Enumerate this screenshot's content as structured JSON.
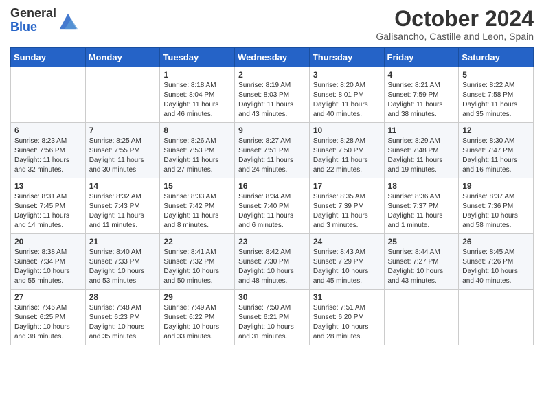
{
  "logo": {
    "general": "General",
    "blue": "Blue"
  },
  "title": "October 2024",
  "location": "Galisancho, Castille and Leon, Spain",
  "days_header": [
    "Sunday",
    "Monday",
    "Tuesday",
    "Wednesday",
    "Thursday",
    "Friday",
    "Saturday"
  ],
  "weeks": [
    [
      {
        "day": "",
        "info": ""
      },
      {
        "day": "",
        "info": ""
      },
      {
        "day": "1",
        "info": "Sunrise: 8:18 AM\nSunset: 8:04 PM\nDaylight: 11 hours and 46 minutes."
      },
      {
        "day": "2",
        "info": "Sunrise: 8:19 AM\nSunset: 8:03 PM\nDaylight: 11 hours and 43 minutes."
      },
      {
        "day": "3",
        "info": "Sunrise: 8:20 AM\nSunset: 8:01 PM\nDaylight: 11 hours and 40 minutes."
      },
      {
        "day": "4",
        "info": "Sunrise: 8:21 AM\nSunset: 7:59 PM\nDaylight: 11 hours and 38 minutes."
      },
      {
        "day": "5",
        "info": "Sunrise: 8:22 AM\nSunset: 7:58 PM\nDaylight: 11 hours and 35 minutes."
      }
    ],
    [
      {
        "day": "6",
        "info": "Sunrise: 8:23 AM\nSunset: 7:56 PM\nDaylight: 11 hours and 32 minutes."
      },
      {
        "day": "7",
        "info": "Sunrise: 8:25 AM\nSunset: 7:55 PM\nDaylight: 11 hours and 30 minutes."
      },
      {
        "day": "8",
        "info": "Sunrise: 8:26 AM\nSunset: 7:53 PM\nDaylight: 11 hours and 27 minutes."
      },
      {
        "day": "9",
        "info": "Sunrise: 8:27 AM\nSunset: 7:51 PM\nDaylight: 11 hours and 24 minutes."
      },
      {
        "day": "10",
        "info": "Sunrise: 8:28 AM\nSunset: 7:50 PM\nDaylight: 11 hours and 22 minutes."
      },
      {
        "day": "11",
        "info": "Sunrise: 8:29 AM\nSunset: 7:48 PM\nDaylight: 11 hours and 19 minutes."
      },
      {
        "day": "12",
        "info": "Sunrise: 8:30 AM\nSunset: 7:47 PM\nDaylight: 11 hours and 16 minutes."
      }
    ],
    [
      {
        "day": "13",
        "info": "Sunrise: 8:31 AM\nSunset: 7:45 PM\nDaylight: 11 hours and 14 minutes."
      },
      {
        "day": "14",
        "info": "Sunrise: 8:32 AM\nSunset: 7:43 PM\nDaylight: 11 hours and 11 minutes."
      },
      {
        "day": "15",
        "info": "Sunrise: 8:33 AM\nSunset: 7:42 PM\nDaylight: 11 hours and 8 minutes."
      },
      {
        "day": "16",
        "info": "Sunrise: 8:34 AM\nSunset: 7:40 PM\nDaylight: 11 hours and 6 minutes."
      },
      {
        "day": "17",
        "info": "Sunrise: 8:35 AM\nSunset: 7:39 PM\nDaylight: 11 hours and 3 minutes."
      },
      {
        "day": "18",
        "info": "Sunrise: 8:36 AM\nSunset: 7:37 PM\nDaylight: 11 hours and 1 minute."
      },
      {
        "day": "19",
        "info": "Sunrise: 8:37 AM\nSunset: 7:36 PM\nDaylight: 10 hours and 58 minutes."
      }
    ],
    [
      {
        "day": "20",
        "info": "Sunrise: 8:38 AM\nSunset: 7:34 PM\nDaylight: 10 hours and 55 minutes."
      },
      {
        "day": "21",
        "info": "Sunrise: 8:40 AM\nSunset: 7:33 PM\nDaylight: 10 hours and 53 minutes."
      },
      {
        "day": "22",
        "info": "Sunrise: 8:41 AM\nSunset: 7:32 PM\nDaylight: 10 hours and 50 minutes."
      },
      {
        "day": "23",
        "info": "Sunrise: 8:42 AM\nSunset: 7:30 PM\nDaylight: 10 hours and 48 minutes."
      },
      {
        "day": "24",
        "info": "Sunrise: 8:43 AM\nSunset: 7:29 PM\nDaylight: 10 hours and 45 minutes."
      },
      {
        "day": "25",
        "info": "Sunrise: 8:44 AM\nSunset: 7:27 PM\nDaylight: 10 hours and 43 minutes."
      },
      {
        "day": "26",
        "info": "Sunrise: 8:45 AM\nSunset: 7:26 PM\nDaylight: 10 hours and 40 minutes."
      }
    ],
    [
      {
        "day": "27",
        "info": "Sunrise: 7:46 AM\nSunset: 6:25 PM\nDaylight: 10 hours and 38 minutes."
      },
      {
        "day": "28",
        "info": "Sunrise: 7:48 AM\nSunset: 6:23 PM\nDaylight: 10 hours and 35 minutes."
      },
      {
        "day": "29",
        "info": "Sunrise: 7:49 AM\nSunset: 6:22 PM\nDaylight: 10 hours and 33 minutes."
      },
      {
        "day": "30",
        "info": "Sunrise: 7:50 AM\nSunset: 6:21 PM\nDaylight: 10 hours and 31 minutes."
      },
      {
        "day": "31",
        "info": "Sunrise: 7:51 AM\nSunset: 6:20 PM\nDaylight: 10 hours and 28 minutes."
      },
      {
        "day": "",
        "info": ""
      },
      {
        "day": "",
        "info": ""
      }
    ]
  ]
}
